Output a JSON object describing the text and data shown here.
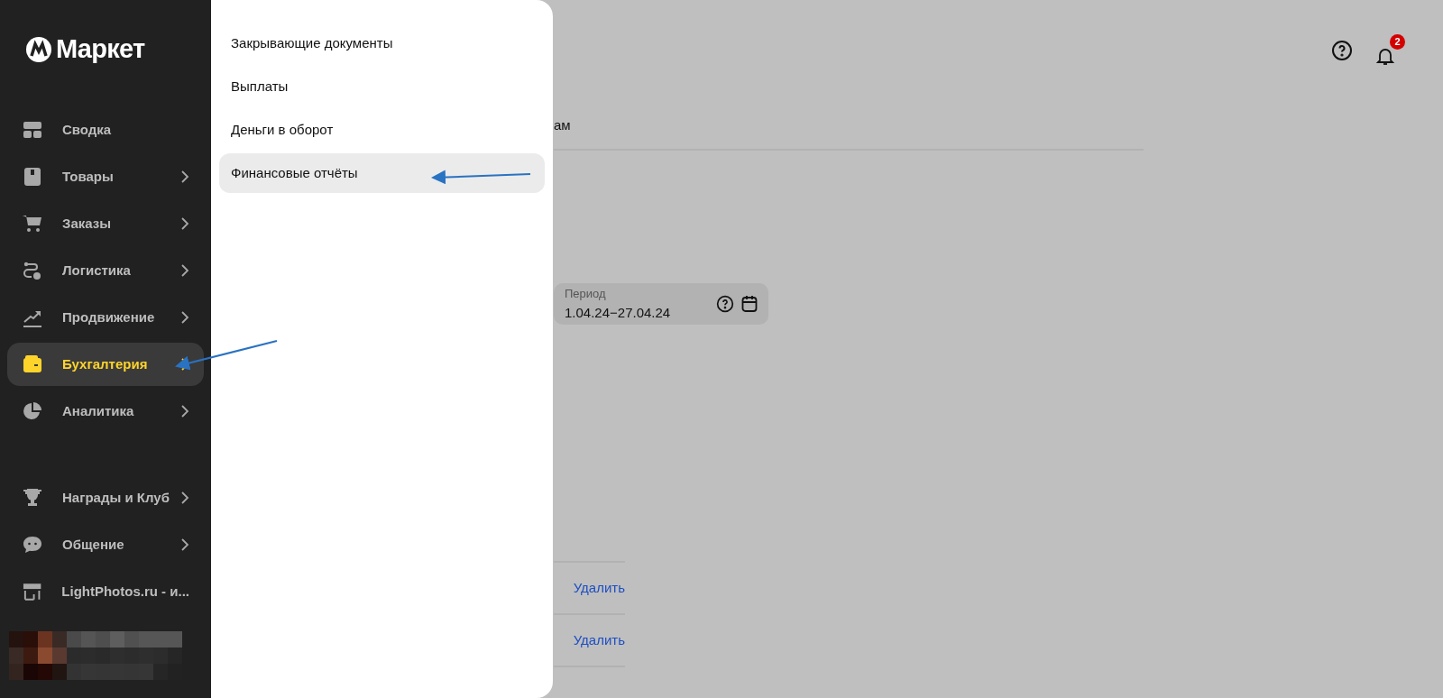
{
  "logo": {
    "text": "Маркет"
  },
  "sidebar": {
    "items": [
      {
        "label": "Сводка",
        "chevron": false,
        "selected": false
      },
      {
        "label": "Товары",
        "chevron": true,
        "selected": false
      },
      {
        "label": "Заказы",
        "chevron": true,
        "selected": false
      },
      {
        "label": "Логистика",
        "chevron": true,
        "selected": false
      },
      {
        "label": "Продвижение",
        "chevron": true,
        "selected": false
      },
      {
        "label": "Бухгалтерия",
        "chevron": true,
        "selected": true
      },
      {
        "label": "Аналитика",
        "chevron": true,
        "selected": false
      }
    ],
    "bottom_items": [
      {
        "label": "Награды и Клуб",
        "chevron": true,
        "selected": false
      },
      {
        "label": "Общение",
        "chevron": true,
        "selected": false
      },
      {
        "label": "LightPhotos.ru - и...",
        "chevron": false,
        "selected": false
      }
    ]
  },
  "submenu": {
    "items": [
      {
        "label": "Закрывающие документы",
        "selected": false
      },
      {
        "label": "Выплаты",
        "selected": false
      },
      {
        "label": "Деньги в оборот",
        "selected": false
      },
      {
        "label": "Финансовые отчёты",
        "selected": true
      }
    ]
  },
  "header": {
    "notifications_badge": "2"
  },
  "page": {
    "tab_fragment": "ам",
    "period": {
      "label": "Период",
      "value": "1.04.24−27.04.24"
    },
    "rows": [
      {
        "action": "Удалить"
      },
      {
        "action": "Удалить"
      }
    ]
  }
}
